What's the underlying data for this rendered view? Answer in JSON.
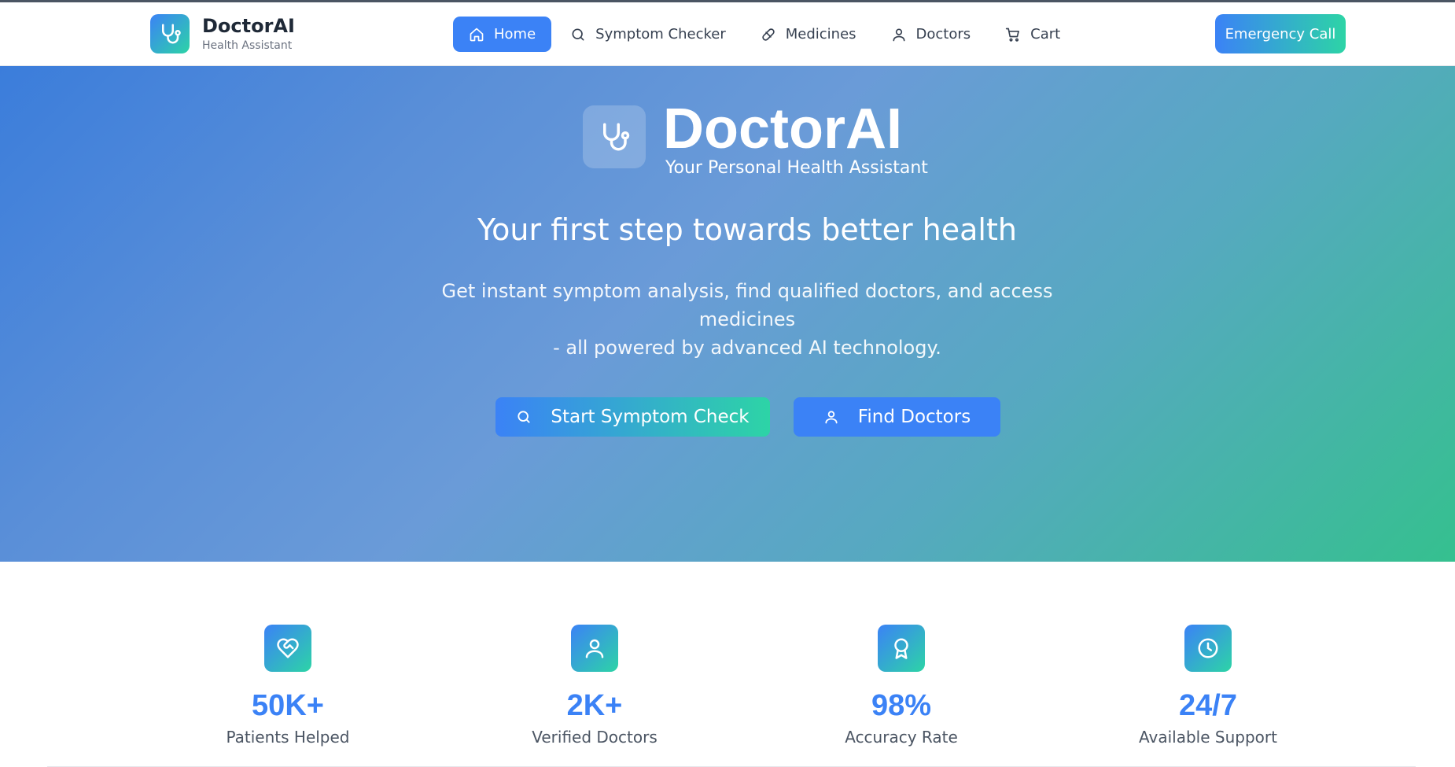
{
  "header": {
    "brand_name": "DoctorAI",
    "brand_subtitle": "Health Assistant",
    "nav": [
      {
        "label": "Home",
        "icon": "home-icon",
        "active": true
      },
      {
        "label": "Symptom Checker",
        "icon": "search-icon",
        "active": false
      },
      {
        "label": "Medicines",
        "icon": "pill-icon",
        "active": false
      },
      {
        "label": "Doctors",
        "icon": "user-icon",
        "active": false
      },
      {
        "label": "Cart",
        "icon": "cart-icon",
        "active": false
      }
    ],
    "emergency_label": "Emergency Call"
  },
  "hero": {
    "title": "DoctorAI",
    "subtitle": "Your Personal Health Assistant",
    "headline": "Your first step towards better health",
    "description_line1": "Get instant symptom analysis, find qualified doctors, and access medicines",
    "description_line2": "- all powered by advanced AI technology.",
    "primary_button": "Start Symptom Check",
    "secondary_button": "Find Doctors"
  },
  "stats": [
    {
      "value": "50K+",
      "label": "Patients Helped",
      "icon": "heart-handshake-icon"
    },
    {
      "value": "2K+",
      "label": "Verified Doctors",
      "icon": "user-icon"
    },
    {
      "value": "98%",
      "label": "Accuracy Rate",
      "icon": "award-icon"
    },
    {
      "value": "24/7",
      "label": "Available Support",
      "icon": "clock-icon"
    }
  ],
  "colors": {
    "accent_blue": "#3b82f6",
    "accent_green": "#2dd4a6",
    "text_dark": "#1f2937"
  }
}
